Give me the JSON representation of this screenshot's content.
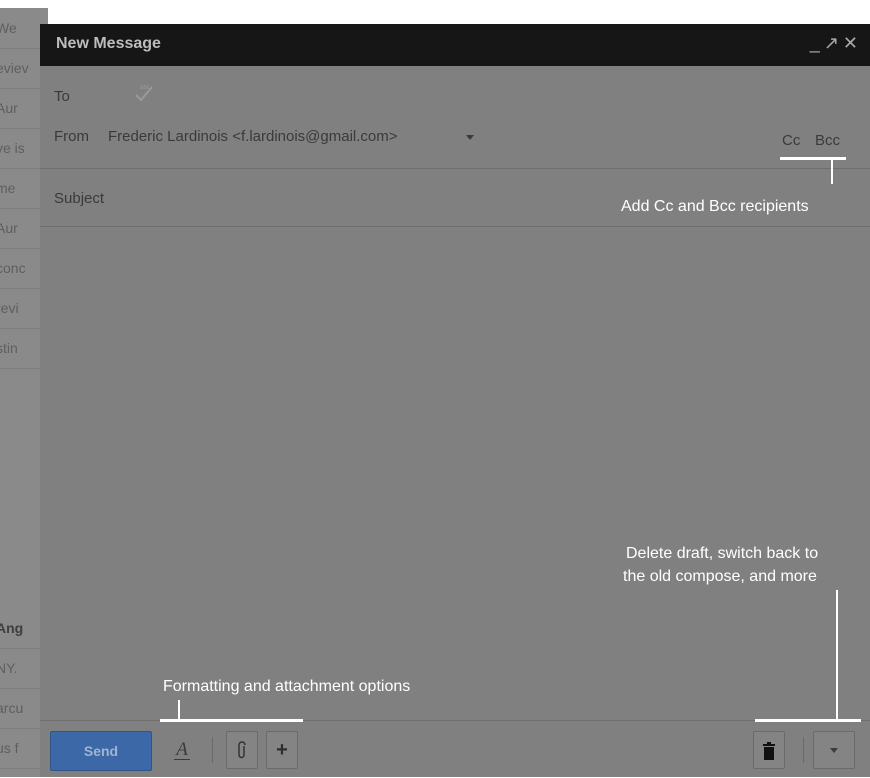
{
  "background_inbox": {
    "rows": [
      "We",
      "eviev",
      "Aur",
      "ve is",
      "me",
      "Aur",
      "conc",
      "revi",
      "stin",
      "Ang",
      "NY.",
      "arcu",
      "us f"
    ]
  },
  "compose": {
    "title": "New Message",
    "controls": {
      "minimize": "_",
      "popout": "↗",
      "close": "✕"
    },
    "to_label": "To",
    "from_label": "From",
    "from_value": "Frederic Lardinois <f.lardinois@gmail.com>",
    "cc_label": "Cc",
    "bcc_label": "Bcc",
    "subject_placeholder": "Subject",
    "send_label": "Send",
    "format_label": "A",
    "more_label": "+"
  },
  "annotations": {
    "cc_bcc": "Add Cc and Bcc recipients",
    "options_line1": "Delete draft, switch back to",
    "options_line2": "the old compose, and more",
    "formatting": "Formatting and attachment options"
  },
  "icons": {
    "spell_check": "check-icon",
    "attach": "paperclip-icon",
    "delete": "trash-icon",
    "options": "chevron-down-icon"
  },
  "colors": {
    "overlay": "#808080",
    "title_bar": "#161616",
    "send_button": "#3c68a8",
    "annotation": "#ffffff"
  }
}
